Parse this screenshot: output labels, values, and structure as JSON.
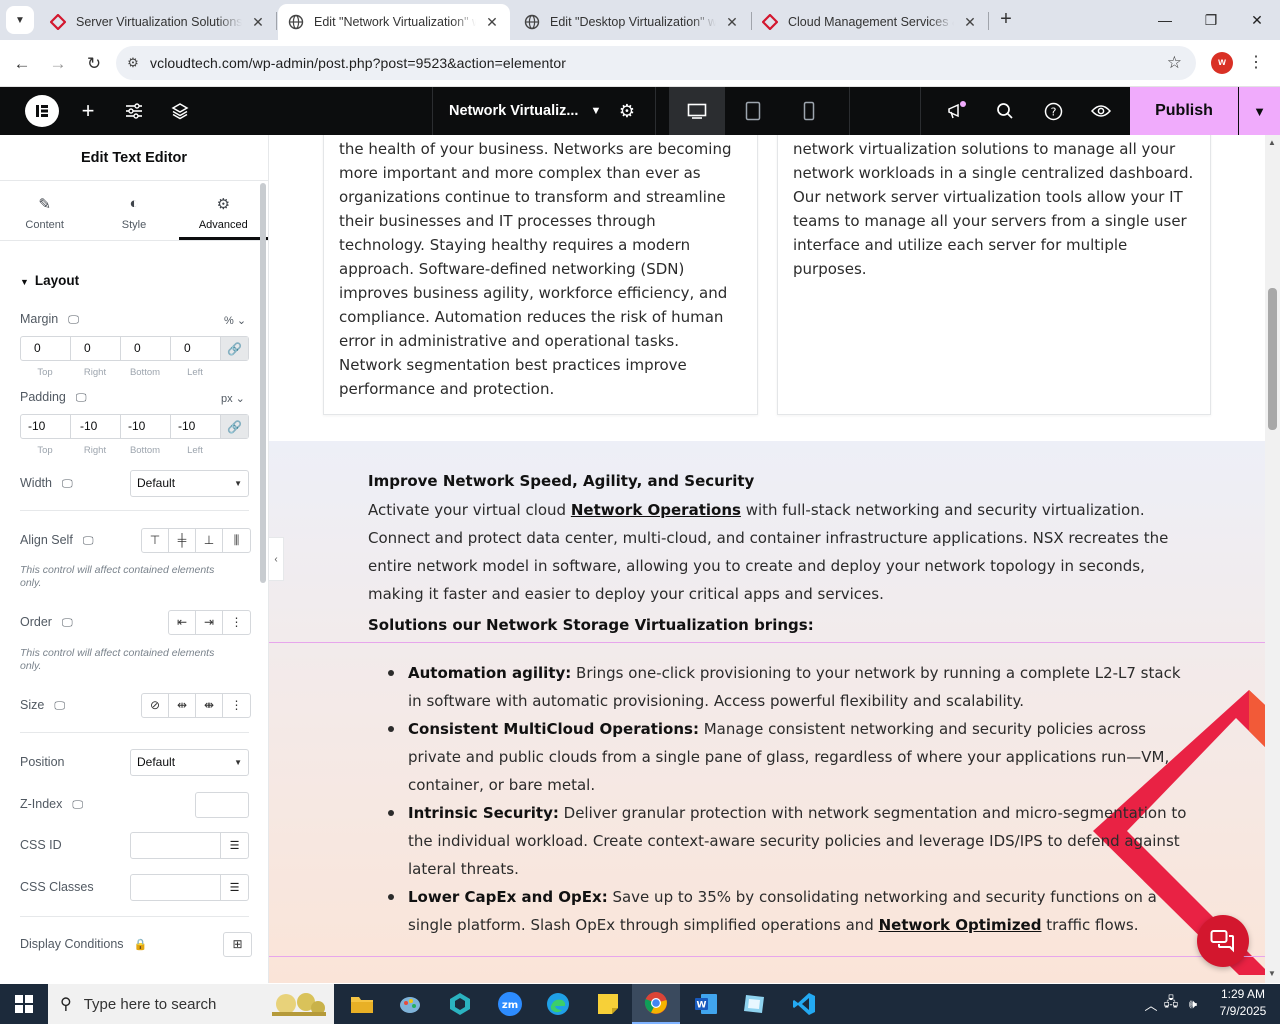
{
  "browser": {
    "tabs": [
      {
        "title": "Server Virtualization Solutions &",
        "active": false
      },
      {
        "title": "Edit \"Network Virtualization\" wi",
        "active": true
      },
      {
        "title": "Edit \"Desktop Virtualization\" wit",
        "active": false
      },
      {
        "title": "Cloud Management Services &",
        "active": false
      }
    ],
    "url": "vcloudtech.com/wp-admin/post.php?post=9523&action=elementor",
    "profile_initial": "w"
  },
  "editor": {
    "document_name": "Network Virtualiz...",
    "publish_label": "Publish",
    "colors": {
      "accent": "#f0abfc",
      "topbar": "#0c0d0e"
    }
  },
  "panel": {
    "title": "Edit Text Editor",
    "tabs": [
      {
        "label": "Content",
        "icon": "pencil-icon"
      },
      {
        "label": "Style",
        "icon": "half-circle-icon"
      },
      {
        "label": "Advanced",
        "icon": "gear-icon"
      }
    ],
    "section": "Layout",
    "margin": {
      "label": "Margin",
      "unit": "%",
      "top": "0",
      "right": "0",
      "bottom": "0",
      "left": "0"
    },
    "padding": {
      "label": "Padding",
      "unit": "px",
      "top": "-10",
      "right": "-10",
      "bottom": "-10",
      "left": "-10"
    },
    "dim_labels": {
      "top": "Top",
      "right": "Right",
      "bottom": "Bottom",
      "left": "Left"
    },
    "width": {
      "label": "Width",
      "value": "Default"
    },
    "align_self": {
      "label": "Align Self",
      "note": "This control will affect contained elements only."
    },
    "order": {
      "label": "Order",
      "note": "This control will affect contained elements only."
    },
    "size": {
      "label": "Size"
    },
    "position": {
      "label": "Position",
      "value": "Default"
    },
    "z_index": {
      "label": "Z-Index"
    },
    "css_id": {
      "label": "CSS ID"
    },
    "css_classes": {
      "label": "CSS Classes"
    },
    "display_conditions": {
      "label": "Display Conditions"
    }
  },
  "canvas": {
    "card_left_text": "the health of your business. Networks are becoming more important and more complex than ever as organizations continue to transform and streamline their businesses and IT processes through technology. Staying healthy requires a modern approach. Software-defined networking (SDN) improves business agility, workforce efficiency, and compliance. Automation reduces the risk of human error in administrative and operational tasks. Network segmentation best practices improve performance and protection.",
    "card_right_text": "network virtualization solutions to manage all your network workloads in a single centralized dashboard. Our network server virtualization tools allow your IT teams to manage all your servers from a single user interface and utilize each server for multiple purposes.",
    "heading": "Improve Network Speed, Agility, and Security",
    "intro_before": " Activate your virtual cloud ",
    "intro_link": "Network Operations",
    "intro_after": " with full-stack networking and security virtualization. Connect and protect data center, multi-cloud, and container infrastructure applications. NSX recreates the entire network model in software, allowing you to create and deploy your network topology in seconds, making it faster and easier to deploy your critical apps and services.",
    "subheading": "Solutions our Network Storage Virtualization brings:",
    "bullets": [
      {
        "title": "Automation agility:",
        "text": " Brings one-click provisioning to your network by running a complete L2-L7 stack in software with automatic provisioning. Access powerful flexibility and scalability."
      },
      {
        "title": "Consistent MultiCloud Operations:",
        "text": " Manage consistent networking and security policies across private and public clouds from a single pane of glass, regardless of where your applications run—VM, container, or bare metal."
      },
      {
        "title": "Intrinsic Security:",
        "text": " Deliver granular protection with network segmentation and micro-segmentation to the individual workload. Create context-aware security policies and leverage IDS/IPS to defend against lateral threats."
      },
      {
        "title": "Lower CapEx and OpEx:",
        "text": " Save up to 35% by consolidating networking and security functions on a single platform. Slash OpEx through simplified operations and ",
        "link": "Network Optimized",
        "after": " traffic flows."
      }
    ]
  },
  "taskbar": {
    "search_placeholder": "Type here to search",
    "time": "1:29 AM",
    "date": "7/9/2025"
  }
}
